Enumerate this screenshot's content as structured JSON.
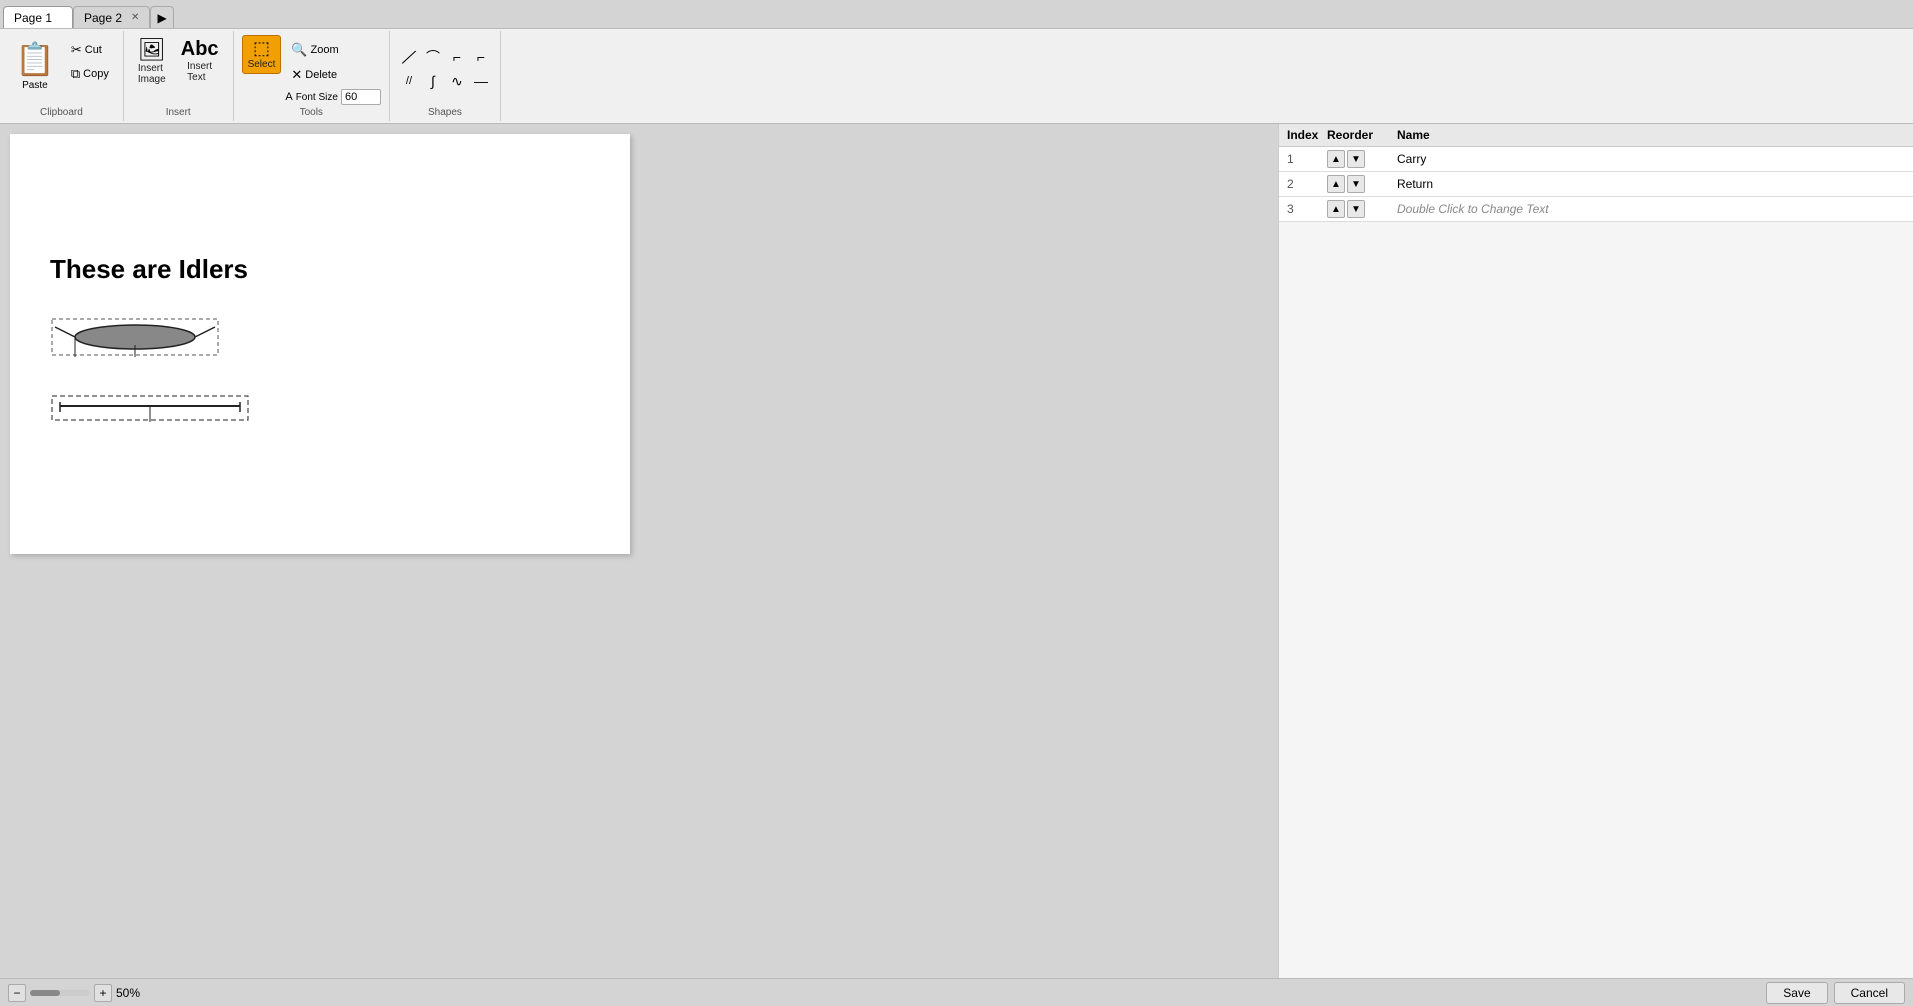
{
  "tabs": [
    {
      "label": "Page 1",
      "active": true,
      "closable": false
    },
    {
      "label": "Page 2",
      "active": false,
      "closable": true
    }
  ],
  "toolbar": {
    "clipboard": {
      "section_label": "Clipboard",
      "paste_label": "Paste",
      "cut_label": "Cut",
      "copy_label": "Copy"
    },
    "insert": {
      "section_label": "Insert",
      "insert_image_label": "Insert\nImage",
      "insert_text_label": "Insert\nText"
    },
    "tools": {
      "section_label": "Tools",
      "select_label": "Select",
      "zoom_label": "Zoom",
      "delete_label": "Delete",
      "font_size_label": "Font Size",
      "font_size_value": "60"
    },
    "shapes": {
      "section_label": "Shapes",
      "shapes": [
        {
          "icon": "╱",
          "name": "line-shape"
        },
        {
          "icon": "⌒",
          "name": "arc-shape"
        },
        {
          "icon": "⌐",
          "name": "rect-corner-shape"
        },
        {
          "icon": "⌐",
          "name": "bracket-shape"
        },
        {
          "icon": "//",
          "name": "double-slash-shape"
        },
        {
          "icon": "∫",
          "name": "curve-shape"
        },
        {
          "icon": "∿",
          "name": "wave-shape"
        },
        {
          "icon": "—",
          "name": "dash-shape"
        }
      ]
    }
  },
  "canvas": {
    "title": "These are Idlers"
  },
  "right_panel": {
    "columns": {
      "index": "Index",
      "reorder": "Reorder",
      "name": "Name"
    },
    "rows": [
      {
        "index": "1",
        "name": "Carry"
      },
      {
        "index": "2",
        "name": "Return"
      },
      {
        "index": "3",
        "name": "Double Click to Change Text"
      }
    ]
  },
  "status_bar": {
    "zoom_level": "50%",
    "save_label": "Save",
    "cancel_label": "Cancel"
  }
}
